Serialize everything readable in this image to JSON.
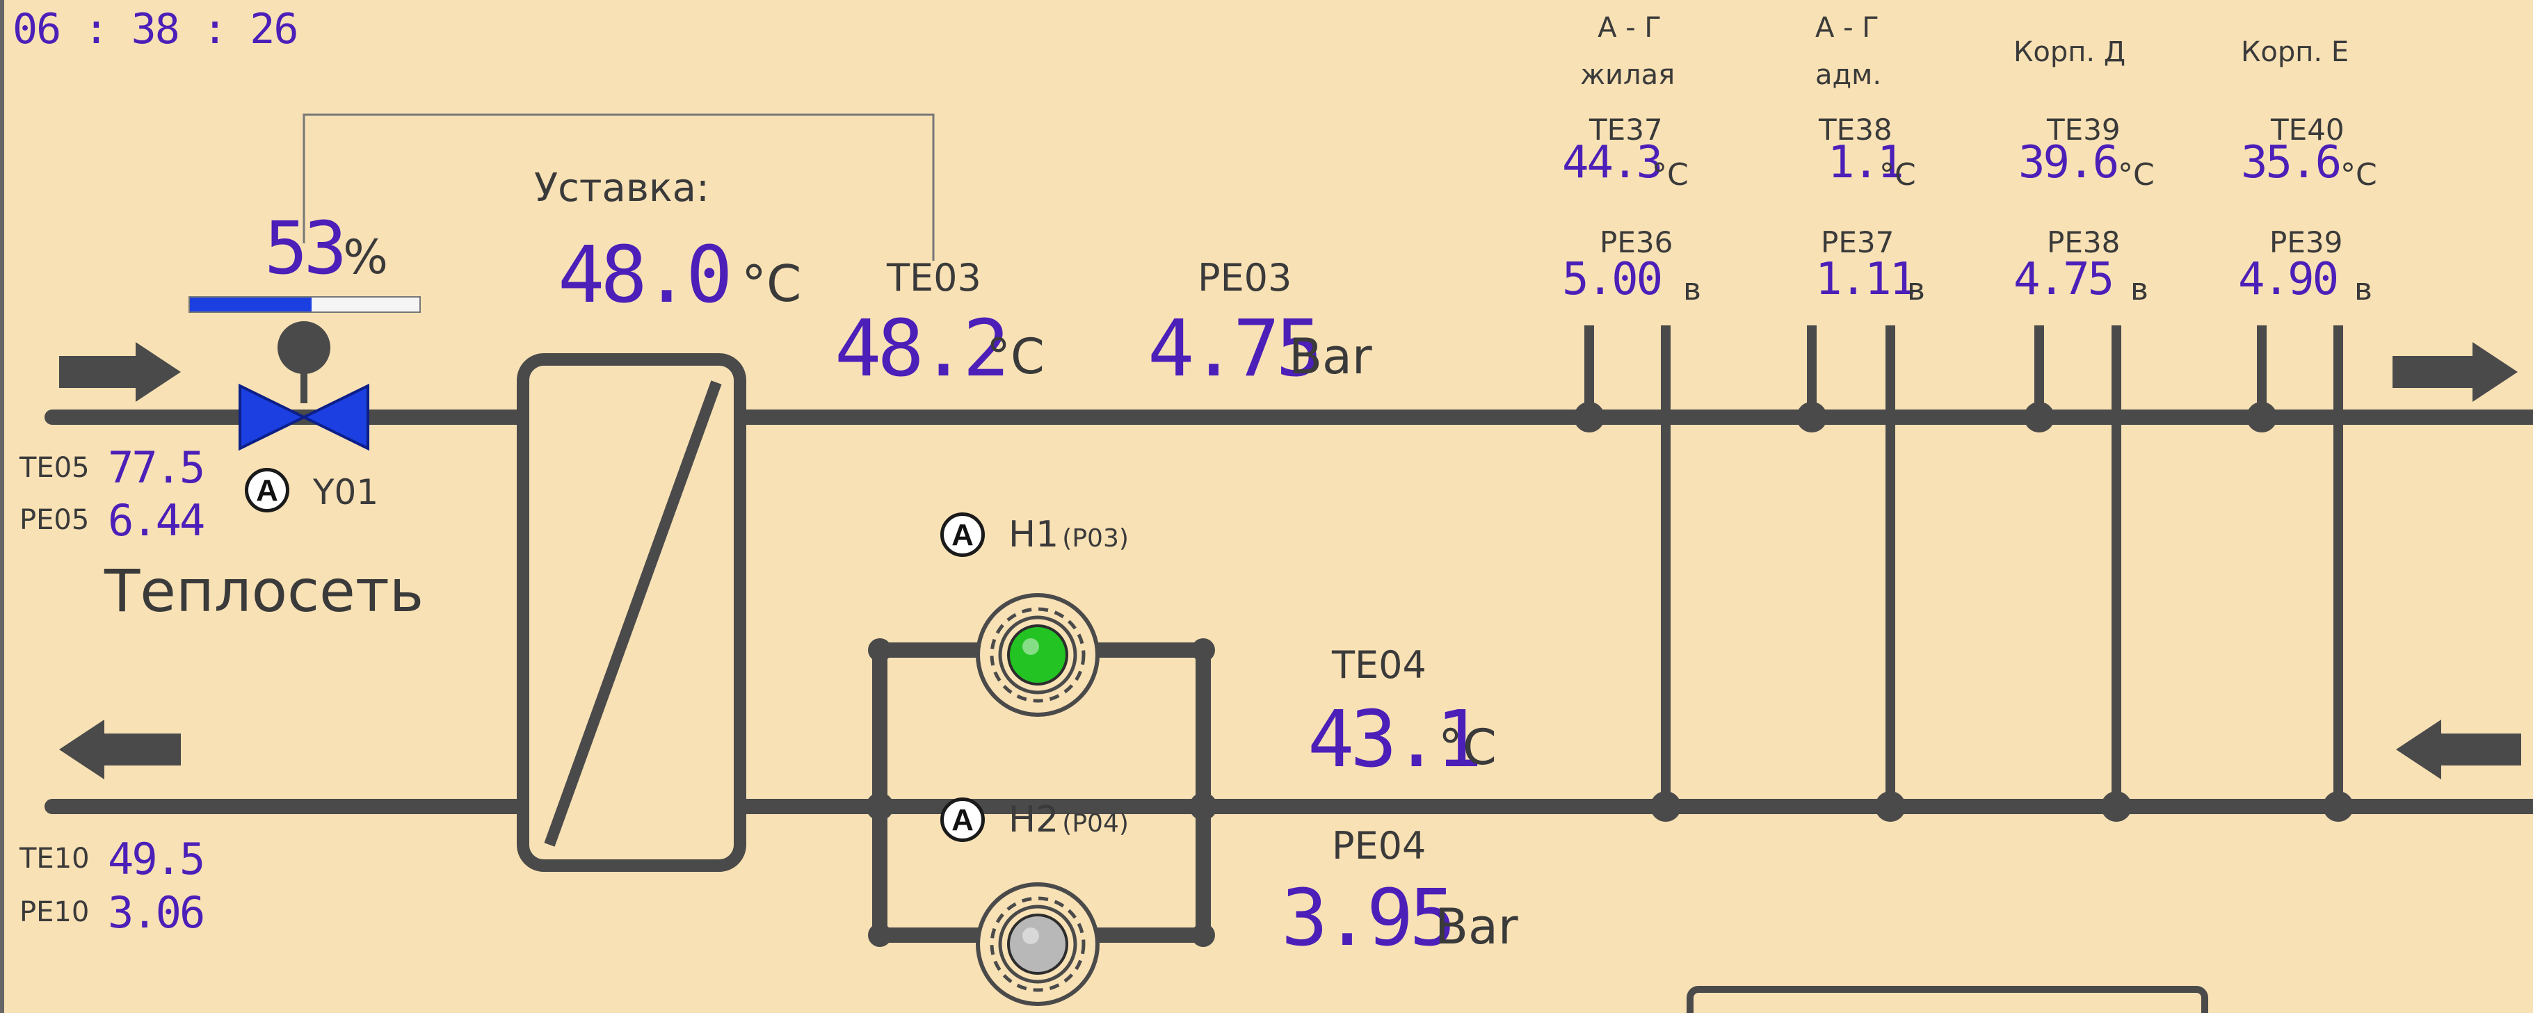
{
  "clock": "06 : 38 : 26",
  "valve": {
    "percent": "53",
    "percent_unit": "%",
    "position_fraction": 0.53,
    "mode_badge": "A",
    "name": "Y01"
  },
  "setpoint": {
    "label": "Уставка:",
    "value": "48.0",
    "unit": "°C"
  },
  "supply": {
    "te03": {
      "label": "TE03",
      "value": "48.2",
      "unit": "°C"
    },
    "pe03": {
      "label": "PE03",
      "value": "4.75",
      "unit": "Bar"
    }
  },
  "return": {
    "te04": {
      "label": "TE04",
      "value": "43.1",
      "unit": "°C"
    },
    "pe04": {
      "label": "PE04",
      "value": "3.95",
      "unit": "Bar"
    }
  },
  "network": {
    "title": "Теплосеть",
    "te05": {
      "label": "TE05",
      "value": "77.5"
    },
    "pe05": {
      "label": "PE05",
      "value": "6.44"
    },
    "te10": {
      "label": "TE10",
      "value": "49.5"
    },
    "pe10": {
      "label": "PE10",
      "value": "3.06"
    }
  },
  "pumps": [
    {
      "badge": "A",
      "name": "H1",
      "tag": "(P03)",
      "state_color": "#22c322"
    },
    {
      "badge": "A",
      "name": "H2",
      "tag": "(P04)",
      "state_color": "#b8b8b8"
    }
  ],
  "consumers": [
    {
      "name_line1": "А - Г",
      "name_line2": "жилая",
      "te_label": "TE37",
      "te_value": "44.3",
      "te_unit": "°C",
      "pe_label": "PE36",
      "pe_value": "5.00",
      "pe_unit": "в"
    },
    {
      "name_line1": "А - Г",
      "name_line2": "адм.",
      "te_label": "TE38",
      "te_value": "1.1",
      "te_unit": "°C",
      "pe_label": "PE37",
      "pe_value": "1.11",
      "pe_unit": "в"
    },
    {
      "name_line1": "Корп. Д",
      "name_line2": "",
      "te_label": "TE39",
      "te_value": "39.6",
      "te_unit": "°C",
      "pe_label": "PE38",
      "pe_value": "4.75",
      "pe_unit": "в"
    },
    {
      "name_line1": "Корп. Е",
      "name_line2": "",
      "te_label": "TE40",
      "te_value": "35.6",
      "te_unit": "°C",
      "pe_label": "PE39",
      "pe_value": "4.90",
      "pe_unit": "в"
    }
  ],
  "colors": {
    "background": "#f8e1b5",
    "pipe": "#4a4a4a",
    "value_text": "#4b1fb8",
    "valve_body": "#1b3fe0",
    "valve_bar": "#1b3fe0"
  }
}
